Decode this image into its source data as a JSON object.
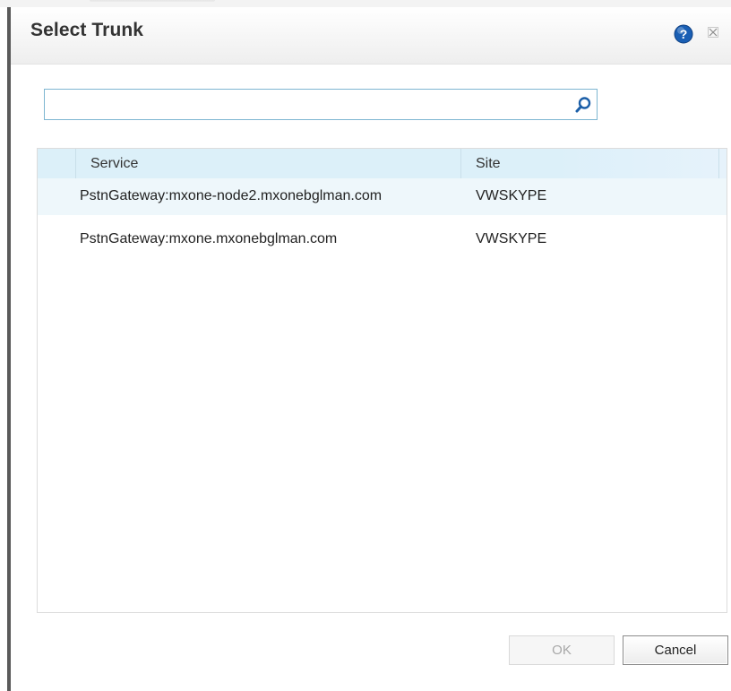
{
  "dialog": {
    "title": "Select Trunk",
    "help_icon": "question-circle-icon",
    "close_icon": "close-icon"
  },
  "search": {
    "value": "",
    "placeholder": "",
    "icon": "magnifier-icon"
  },
  "table": {
    "columns": [
      "Service",
      "Site"
    ],
    "rows": [
      {
        "service": "PstnGateway:mxone-node2.mxonebglman.com",
        "site": "VWSKYPE"
      },
      {
        "service": "PstnGateway:mxone.mxonebglman.com",
        "site": "VWSKYPE"
      }
    ]
  },
  "buttons": {
    "ok_label": "OK",
    "ok_state": "disabled",
    "cancel_label": "Cancel"
  },
  "colors": {
    "header_bg": "#dcf0f9",
    "selected_row_bg": "#eef7fb",
    "search_border": "#7eb6d1",
    "help_icon": "#1a5fb4"
  }
}
